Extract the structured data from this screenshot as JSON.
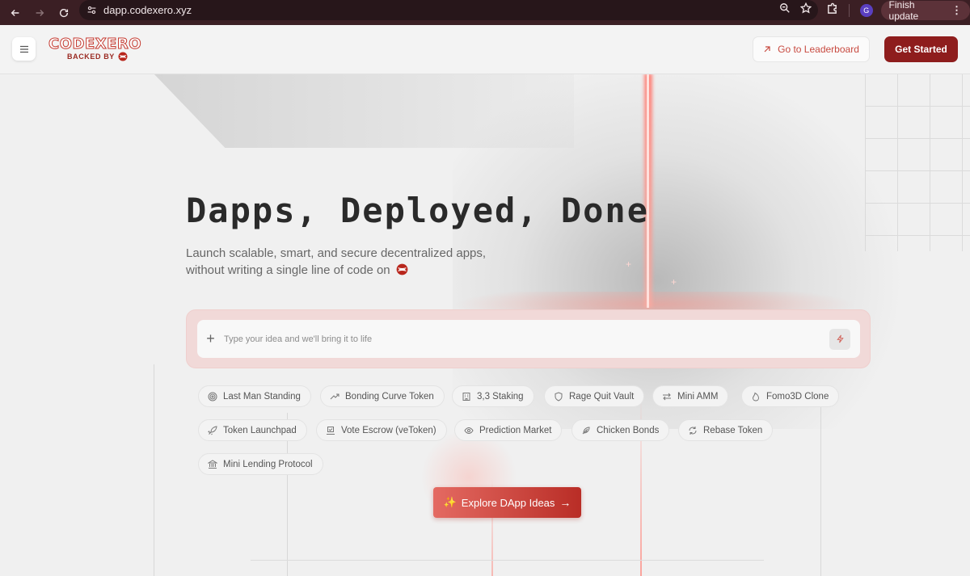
{
  "browser": {
    "url": "dapp.codexero.xyz",
    "profile_initial": "G",
    "finish_update_label": "Finish update"
  },
  "header": {
    "logo_text": "CODEXERO",
    "backed_by": "BACKED BY",
    "leaderboard_label": "Go to Leaderboard",
    "get_started_label": "Get Started"
  },
  "hero": {
    "title": "Dapps, Deployed, Done",
    "subtitle": "Launch scalable, smart, and secure decentralized apps, without writing a single line of code on"
  },
  "prompt": {
    "placeholder": "Type your idea and we'll bring it to life"
  },
  "chips": [
    {
      "label": "Last Man Standing",
      "icon": "target-icon"
    },
    {
      "label": "Bonding Curve Token",
      "icon": "trend-up-icon"
    },
    {
      "label": "3,3 Staking",
      "icon": "building-icon"
    },
    {
      "label": "Rage Quit Vault",
      "icon": "shield-icon"
    },
    {
      "label": "Mini AMM",
      "icon": "swap-icon"
    },
    {
      "label": "Fomo3D Clone",
      "icon": "flame-icon"
    },
    {
      "label": "Token Launchpad",
      "icon": "rocket-icon"
    },
    {
      "label": "Vote Escrow (veToken)",
      "icon": "ballot-icon"
    },
    {
      "label": "Prediction Market",
      "icon": "eye-icon"
    },
    {
      "label": "Chicken Bonds",
      "icon": "feather-icon"
    },
    {
      "label": "Rebase Token",
      "icon": "refresh-icon"
    },
    {
      "label": "Mini Lending Protocol",
      "icon": "bank-icon"
    }
  ],
  "explore": {
    "label": "Explore DApp Ideas",
    "sparkle": "✨",
    "arrow": "→"
  },
  "colors": {
    "brand_red": "#8e1d1d",
    "accent_red": "#c84a40",
    "chrome_bg": "#3b1f24"
  }
}
